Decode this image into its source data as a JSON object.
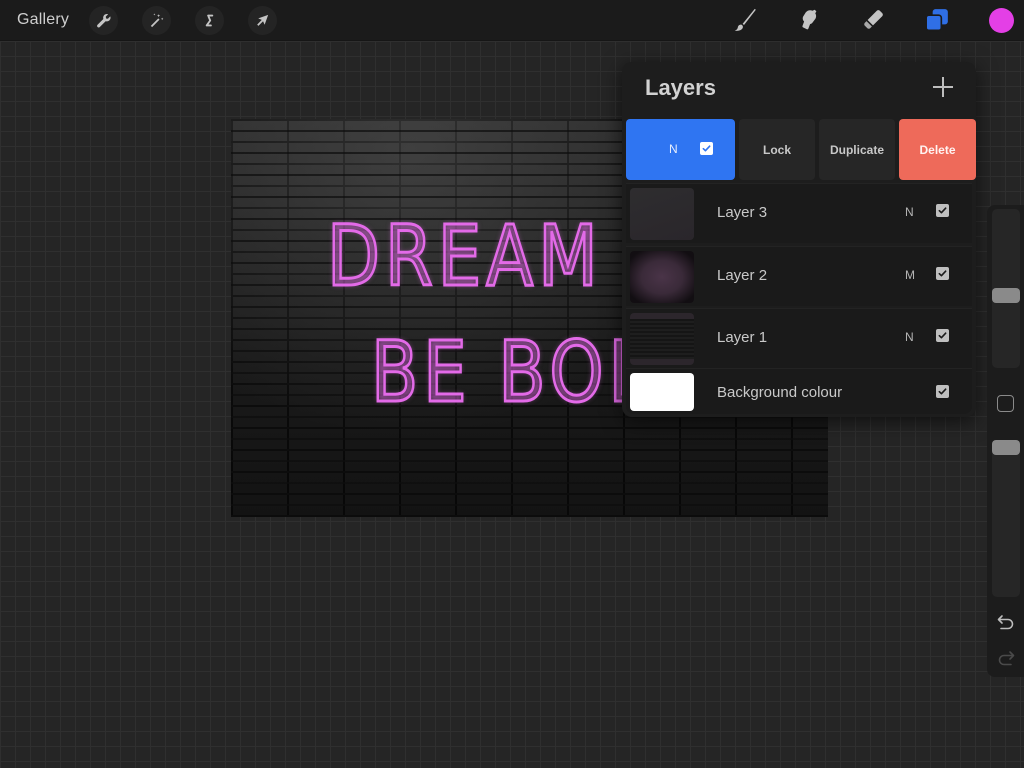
{
  "topbar": {
    "gallery_label": "Gallery",
    "left_tools": [
      {
        "name": "actions",
        "icon": "wrench-icon"
      },
      {
        "name": "adjustments",
        "icon": "magic-wand-icon"
      },
      {
        "name": "selection",
        "icon": "selection-s-icon"
      },
      {
        "name": "transform",
        "icon": "arrow-cursor-icon"
      }
    ],
    "right_tools": [
      {
        "name": "brush",
        "icon": "brush-icon",
        "active": false
      },
      {
        "name": "smudge",
        "icon": "smudge-finger-icon",
        "active": false
      },
      {
        "name": "eraser",
        "icon": "eraser-icon",
        "active": false
      },
      {
        "name": "layers",
        "icon": "layers-icon",
        "active": true
      }
    ],
    "current_color": "#e43fe6",
    "active_tool_color": "#2f6fe6"
  },
  "artwork": {
    "line1": "DREAM",
    "line2": "BE BOLD",
    "neon_color": "#e36ae8"
  },
  "layers_panel": {
    "title": "Layers",
    "add_icon": "plus-icon",
    "selected_layer": {
      "blend_mode": "N",
      "visible": true
    },
    "actions": {
      "lock": "Lock",
      "duplicate": "Duplicate",
      "delete": "Delete"
    },
    "layers": [
      {
        "name": "Layer 3",
        "blend_mode": "N",
        "visible": true
      },
      {
        "name": "Layer 2",
        "blend_mode": "M",
        "visible": true
      },
      {
        "name": "Layer 1",
        "blend_mode": "N",
        "visible": true
      },
      {
        "name": "Background colour",
        "blend_mode": "",
        "visible": true
      }
    ],
    "colors": {
      "selected": "#2f75f2",
      "delete": "#ee6a5a"
    }
  },
  "sidebar": {
    "brush_size_level": 0.45,
    "brush_opacity_level": 1.0,
    "modify_icon": "square-icon",
    "undo_icon": "undo-arrow-icon",
    "redo_icon": "redo-arrow-icon"
  }
}
